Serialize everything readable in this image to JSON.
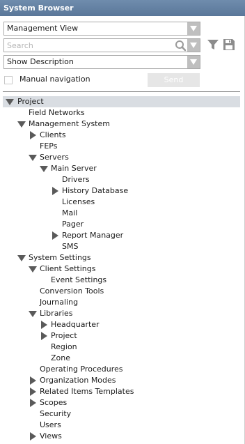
{
  "window": {
    "title": "System Browser"
  },
  "view_selector": {
    "value": "Management View"
  },
  "search": {
    "placeholder": "Search"
  },
  "description_selector": {
    "value": "Show Description"
  },
  "manual_navigation": {
    "label": "Manual navigation",
    "checked": false
  },
  "send_button": {
    "label": "Send"
  },
  "toolbar_icons": [
    "magnifier-icon",
    "filter-icon",
    "save-icon"
  ],
  "tree": [
    {
      "label": "Project",
      "level": 0,
      "toggle": "expanded",
      "selected": true
    },
    {
      "label": "Field Networks",
      "level": 1,
      "toggle": "none"
    },
    {
      "label": "Management System",
      "level": 1,
      "toggle": "expanded"
    },
    {
      "label": "Clients",
      "level": 2,
      "toggle": "collapsed"
    },
    {
      "label": "FEPs",
      "level": 2,
      "toggle": "none"
    },
    {
      "label": "Servers",
      "level": 2,
      "toggle": "expanded"
    },
    {
      "label": "Main Server",
      "level": 3,
      "toggle": "expanded"
    },
    {
      "label": "Drivers",
      "level": 4,
      "toggle": "none"
    },
    {
      "label": "History Database",
      "level": 4,
      "toggle": "collapsed"
    },
    {
      "label": "Licenses",
      "level": 4,
      "toggle": "none"
    },
    {
      "label": "Mail",
      "level": 4,
      "toggle": "none"
    },
    {
      "label": "Pager",
      "level": 4,
      "toggle": "none"
    },
    {
      "label": "Report Manager",
      "level": 4,
      "toggle": "collapsed"
    },
    {
      "label": "SMS",
      "level": 4,
      "toggle": "none"
    },
    {
      "label": "System Settings",
      "level": 1,
      "toggle": "expanded"
    },
    {
      "label": "Client Settings",
      "level": 2,
      "toggle": "expanded"
    },
    {
      "label": "Event Settings",
      "level": 3,
      "toggle": "none"
    },
    {
      "label": "Conversion Tools",
      "level": 2,
      "toggle": "none"
    },
    {
      "label": "Journaling",
      "level": 2,
      "toggle": "none"
    },
    {
      "label": "Libraries",
      "level": 2,
      "toggle": "expanded"
    },
    {
      "label": "Headquarter",
      "level": 3,
      "toggle": "collapsed"
    },
    {
      "label": "Project",
      "level": 3,
      "toggle": "collapsed"
    },
    {
      "label": "Region",
      "level": 3,
      "toggle": "none"
    },
    {
      "label": "Zone",
      "level": 3,
      "toggle": "none"
    },
    {
      "label": "Operating Procedures",
      "level": 2,
      "toggle": "none"
    },
    {
      "label": "Organization Modes",
      "level": 2,
      "toggle": "collapsed"
    },
    {
      "label": "Related Items Templates",
      "level": 2,
      "toggle": "collapsed"
    },
    {
      "label": "Scopes",
      "level": 2,
      "toggle": "collapsed"
    },
    {
      "label": "Security",
      "level": 2,
      "toggle": "none"
    },
    {
      "label": "Users",
      "level": 2,
      "toggle": "none"
    },
    {
      "label": "Views",
      "level": 2,
      "toggle": "collapsed"
    }
  ]
}
